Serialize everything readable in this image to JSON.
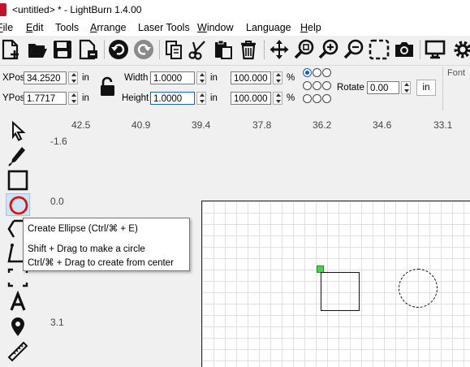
{
  "window": {
    "title": "<untitled> * - LightBurn 1.4.00"
  },
  "menus": [
    {
      "label": "File",
      "key": "F",
      "rest": "ile"
    },
    {
      "label": "Edit",
      "key": "E",
      "rest": "dit"
    },
    {
      "label": "Tools",
      "key": "",
      "rest": "Tools"
    },
    {
      "label": "Arrange",
      "key": "A",
      "rest": "rrange"
    },
    {
      "label": "Laser Tools",
      "key": "",
      "rest": "Laser Tools"
    },
    {
      "label": "Window",
      "key": "W",
      "rest": "indow"
    },
    {
      "label": "Language",
      "key": "",
      "rest": "Language"
    },
    {
      "label": "Help",
      "key": "H",
      "rest": "elp"
    }
  ],
  "toolbar_icons": [
    "new-file-icon",
    "open-folder-icon",
    "save-icon",
    "import-icon",
    "undo-icon",
    "redo-icon",
    "copy-icon",
    "cut-icon",
    "paste-icon",
    "delete-icon",
    "move-icon",
    "zoom-selection-icon",
    "zoom-in-icon",
    "zoom-out-icon",
    "zoom-frame-icon",
    "camera-icon",
    "monitor-icon",
    "settings-icon"
  ],
  "numeric_edits": {
    "xpos_label": "XPos",
    "xpos_value": "34.2520",
    "xpos_unit": "in",
    "ypos_label": "YPos",
    "ypos_value": "1.7717",
    "ypos_unit": "in",
    "width_label": "Width",
    "width_value": "1.0000",
    "width_unit": "in",
    "height_label": "Height",
    "height_value": "1.0000",
    "height_unit": "in",
    "scale_x_value": "100.000",
    "scale_y_value": "100.000",
    "percent": "%",
    "rotate_label": "Rotate",
    "rotate_value": "0.00",
    "units_button": "in",
    "font_label": "Font"
  },
  "tools": [
    "select-icon",
    "edit-nodes-icon",
    "rectangle-icon",
    "ellipse-icon",
    "polygon-icon",
    "polyline-icon",
    "frame-icon",
    "text-icon",
    "position-laser-icon",
    "measure-icon"
  ],
  "ruler": {
    "top": [
      "42.5",
      "40.9",
      "39.4",
      "37.8",
      "36.2",
      "34.6",
      "33.1"
    ],
    "left": [
      "-1.6",
      "0.0",
      "3.1"
    ]
  },
  "tooltip": {
    "title": "Create Ellipse (Ctrl/⌘ + E)",
    "line1": "Shift + Drag to make a circle",
    "line2": "Ctrl/⌘ + Drag to create from center"
  },
  "colors": {
    "accent": "#0a5fbf",
    "logo": "#c8102e",
    "selection_handle": "#4cd04c"
  }
}
